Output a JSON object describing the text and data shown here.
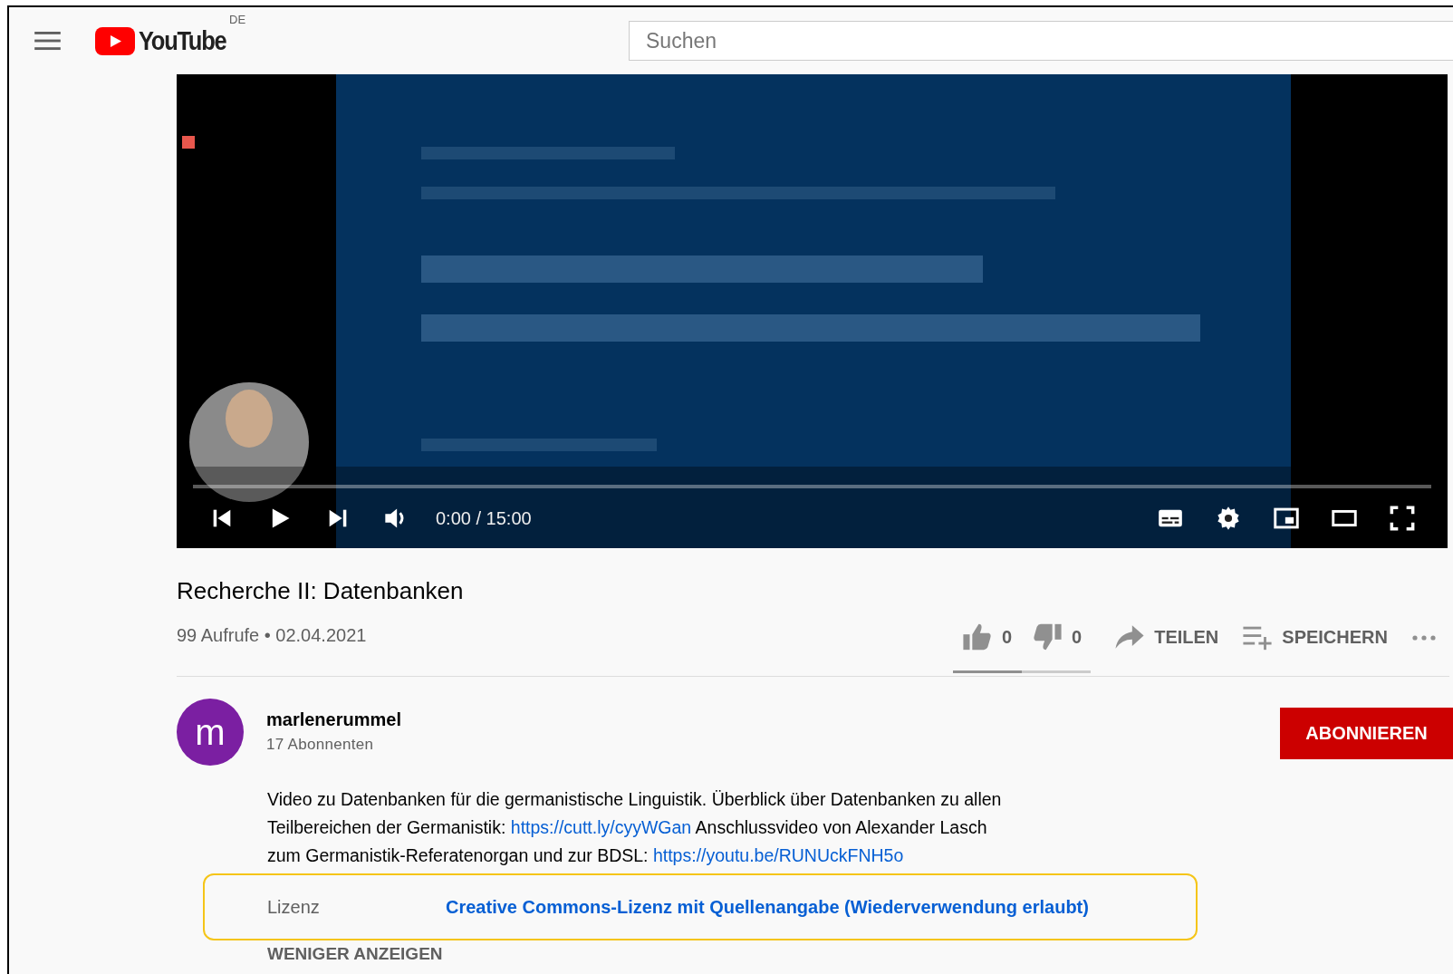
{
  "header": {
    "logo": "YouTube",
    "region": "DE",
    "search": {
      "placeholder": "Suchen"
    }
  },
  "player": {
    "progress": {
      "level": 0
    },
    "playing": false,
    "time": "0:00 / 15:00"
  },
  "video": {
    "title": "Recherche II: Datenbanken",
    "meta": "99 Aufrufe • 02.04.2021"
  },
  "actions": {
    "likes": "0",
    "dislikes": "0",
    "share": "TEILEN",
    "save": "SPEICHERN",
    "rating_bar": {
      "level": 0.5
    }
  },
  "channel": {
    "name": "marlenerummel",
    "avatar_letter": "m",
    "subscribers": "17 Abonnenten",
    "subscribe": "ABONNIEREN"
  },
  "description": {
    "lines": [
      [
        {
          "kind": "text",
          "text": "Video zu Datenbanken für die germanistische Linguistik. Überblick über Datenbanken zu allen"
        }
      ],
      [
        {
          "kind": "text",
          "text": "Teilbereichen der Germanistik: "
        },
        {
          "kind": "link",
          "text": "https://cutt.ly/cyyWGan"
        },
        {
          "kind": "text",
          "text": " Anschlussvideo von Alexander Lasch"
        }
      ],
      [
        {
          "kind": "text",
          "text": "zum Germanistik-Referatenorgan und zur BDSL: "
        },
        {
          "kind": "link",
          "text": "https://youtu.be/RUNUckFNH5o"
        }
      ]
    ]
  },
  "license": {
    "label": "Lizenz",
    "value": "Creative Commons-Lizenz mit Quellenangabe (Wiederverwendung erlaubt)",
    "highlighted": true
  },
  "show_less": "WENIGER ANZEIGEN"
}
